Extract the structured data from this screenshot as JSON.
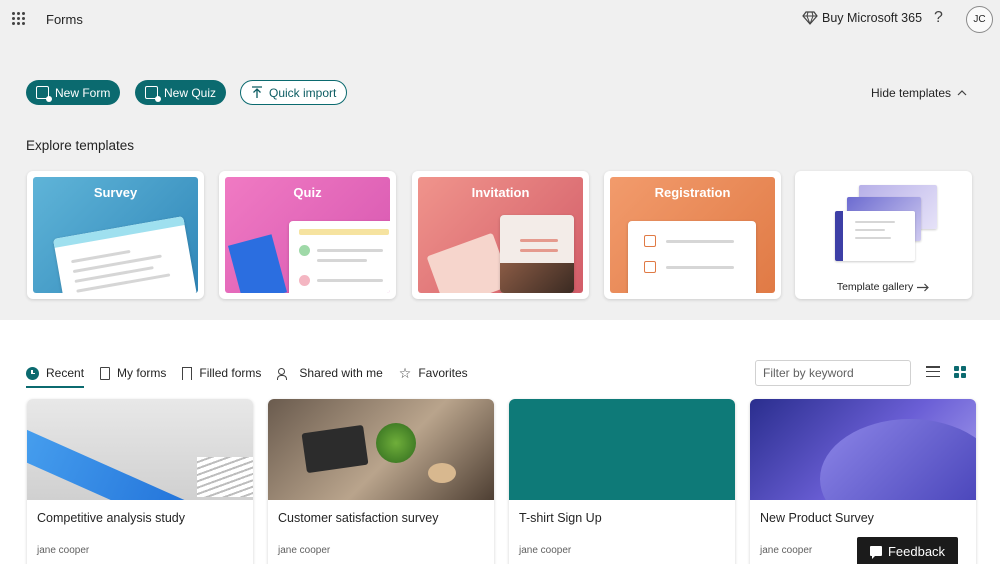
{
  "header": {
    "app_title": "Forms",
    "buy_label": "Buy Microsoft 365",
    "help_label": "?",
    "avatar_initials": "JC"
  },
  "actions": {
    "new_form": "New Form",
    "new_quiz": "New Quiz",
    "quick_import": "Quick import",
    "hide_templates": "Hide templates"
  },
  "templates": {
    "heading": "Explore templates",
    "items": [
      {
        "label": "Survey"
      },
      {
        "label": "Quiz"
      },
      {
        "label": "Invitation"
      },
      {
        "label": "Registration"
      }
    ],
    "gallery_label": "Template gallery"
  },
  "tabs": [
    {
      "label": "Recent",
      "active": true
    },
    {
      "label": "My forms"
    },
    {
      "label": "Filled forms"
    },
    {
      "label": "Shared with me"
    },
    {
      "label": "Favorites"
    }
  ],
  "filter": {
    "placeholder": "Filter by keyword"
  },
  "forms": [
    {
      "title": "Competitive analysis study",
      "owner": "jane cooper"
    },
    {
      "title": "Customer satisfaction survey",
      "owner": "jane cooper"
    },
    {
      "title": "T-shirt Sign Up",
      "owner": "jane cooper"
    },
    {
      "title": "New Product Survey",
      "owner": "jane cooper"
    }
  ],
  "feedback_label": "Feedback",
  "colors": {
    "accent": "#0b6a6f",
    "top_bg": "#f0f0f0"
  }
}
